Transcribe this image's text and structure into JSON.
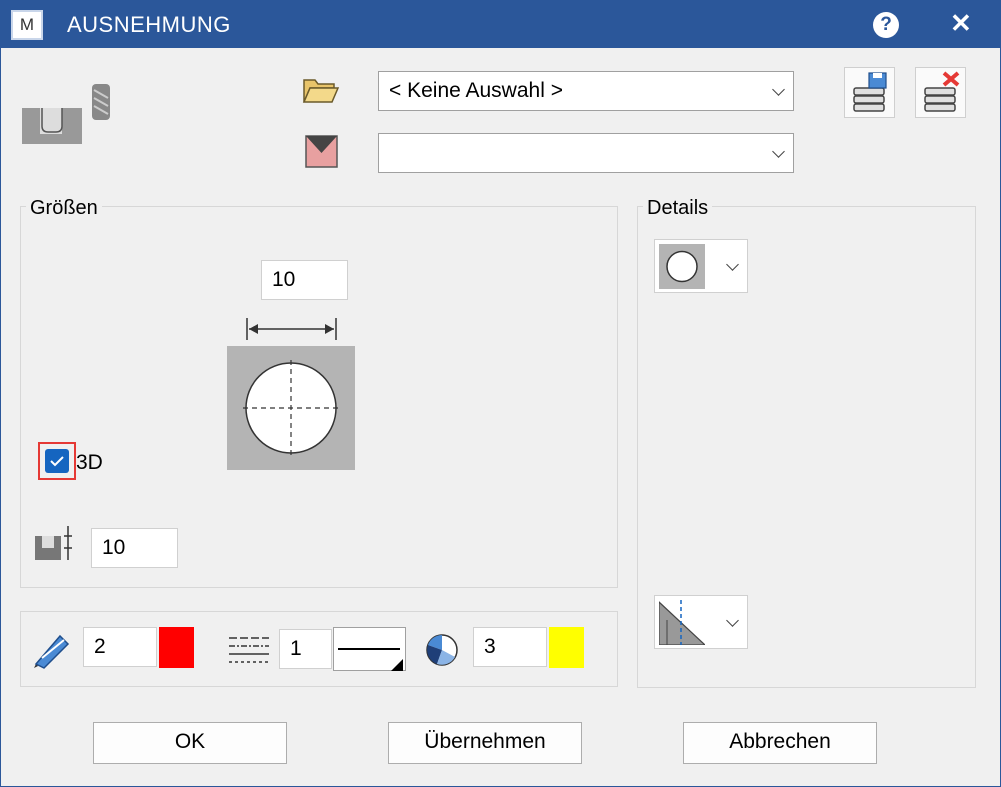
{
  "window": {
    "title": "AUSNEHMUNG",
    "app_icon_letter": "M",
    "help_symbol": "?",
    "close_symbol": "✕"
  },
  "header": {
    "folder_combo_value": "< Keine Auswahl >",
    "color_combo_value": ""
  },
  "groessen": {
    "label": "Größen",
    "width_value": "10",
    "checkbox_3d_label": "3D",
    "checkbox_3d_checked": true,
    "depth_value": "10"
  },
  "details": {
    "label": "Details"
  },
  "properties": {
    "pen_value": "2",
    "pen_color": "#ff0000",
    "linetype_value": "1",
    "pattern_value": "3",
    "pattern_color": "#ffff00"
  },
  "buttons": {
    "ok": "OK",
    "apply": "Übernehmen",
    "cancel": "Abbrechen"
  },
  "colors": {
    "titlebar": "#2b579a",
    "checkbox": "#1565c0",
    "checkbox_focus": "#e53935"
  }
}
